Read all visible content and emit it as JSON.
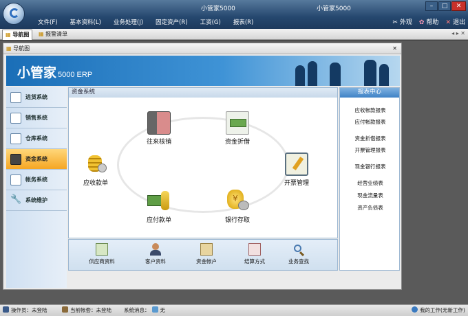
{
  "window": {
    "title_left": "小管家5000",
    "title_right": "小管家5000",
    "btn_min": "–",
    "btn_max": "□",
    "btn_close": "✕"
  },
  "menu": {
    "items": [
      "文件(F)",
      "基本资料(L)",
      "业务处理(J)",
      "固定资产(R)",
      "工资(G)",
      "报表(R)"
    ],
    "right": [
      {
        "icon": "✂",
        "label": "外观"
      },
      {
        "icon": "✿",
        "label": "帮助"
      },
      {
        "icon": "✕",
        "label": "退出"
      }
    ]
  },
  "tabs": [
    {
      "label": "导航图"
    },
    {
      "label": "报警清单"
    }
  ],
  "tab_arrows": "◂ ▸ ✕",
  "panel": {
    "title": "导航图",
    "close": "✕"
  },
  "banner": {
    "brand_cn": "小管家",
    "brand_en": "5000 ERP"
  },
  "sidebar": {
    "items": [
      "进货系统",
      "销售系统",
      "仓库系统",
      "资金系统",
      "帐务系统",
      "系统维护"
    ],
    "active_index": 3
  },
  "main": {
    "title": "资金系统",
    "nodes": [
      "往来核销",
      "资金折借",
      "开票管理",
      "银行存取",
      "应付款单",
      "应收款单"
    ]
  },
  "quick": {
    "items": [
      "供应商资料",
      "客户资料",
      "资金帐户",
      "结算方式",
      "业务查找"
    ]
  },
  "report": {
    "title": "报表中心",
    "items": [
      "应收帐款报表",
      "应付帐款报表",
      "资金折借报表",
      "开票管理报表",
      "现金银行报表",
      "经营业绩表",
      "现金流量表",
      "资产负债表"
    ]
  },
  "status": {
    "operator": "操作员：未登陆",
    "account": "当前帐套：未登陆",
    "message_label": "系统消息：",
    "message_value": "无",
    "work": "我的工作(无新工作)"
  },
  "colors": {
    "titlebar": "#25476e",
    "active_side": "#f5a623",
    "accent_blue": "#3f82c6",
    "close_red": "#c8312a"
  }
}
